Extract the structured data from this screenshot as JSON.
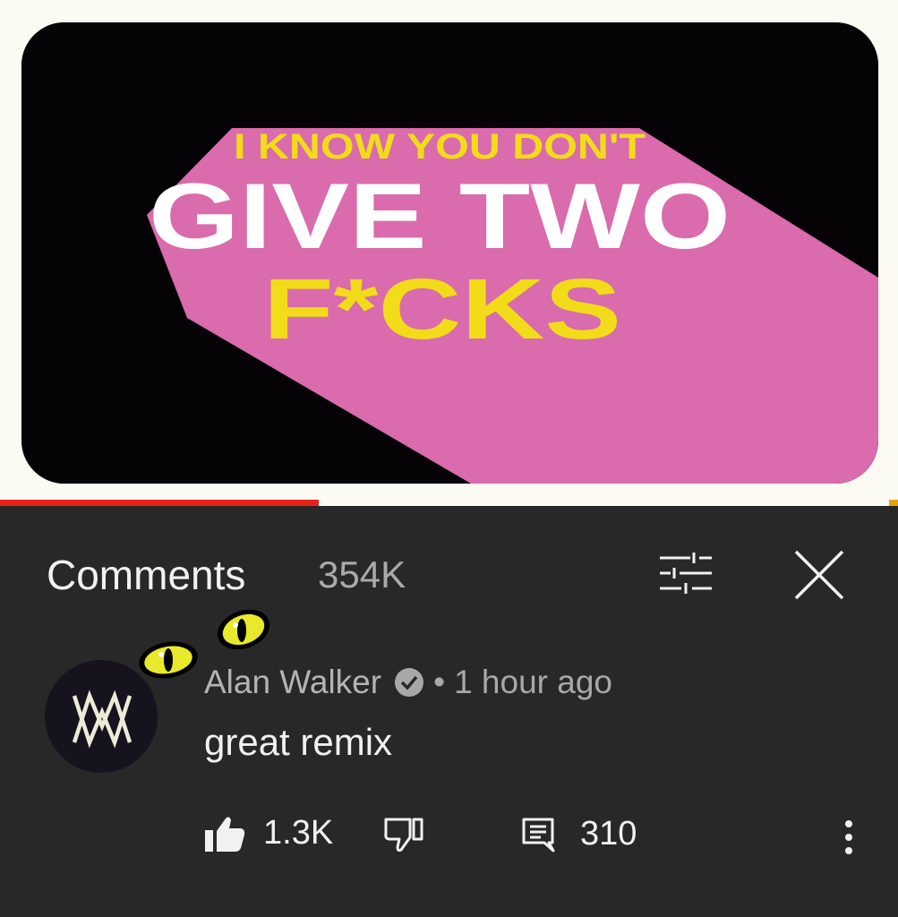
{
  "video": {
    "line1": "I KNOW YOU DON'T",
    "line2": "GIVE TWO",
    "line3": "F*CKS",
    "progress_fraction": 0.355
  },
  "colors": {
    "accent_red": "#e62117",
    "pink": "#da6bac",
    "yellow_text": "#f2dc1a",
    "panel_bg": "#282828"
  },
  "comments": {
    "title": "Comments",
    "count": "354K",
    "filter_icon": "sliders-icon",
    "close_icon": "close-icon"
  },
  "comment": {
    "author": "Alan Walker",
    "separator": "•",
    "time": "1 hour ago",
    "text": "great remix",
    "likes": "1.3K",
    "replies": "310",
    "icons": [
      "thumbs-up-icon",
      "thumbs-down-icon",
      "reply-icon",
      "more-vert-icon",
      "verified-icon"
    ]
  }
}
